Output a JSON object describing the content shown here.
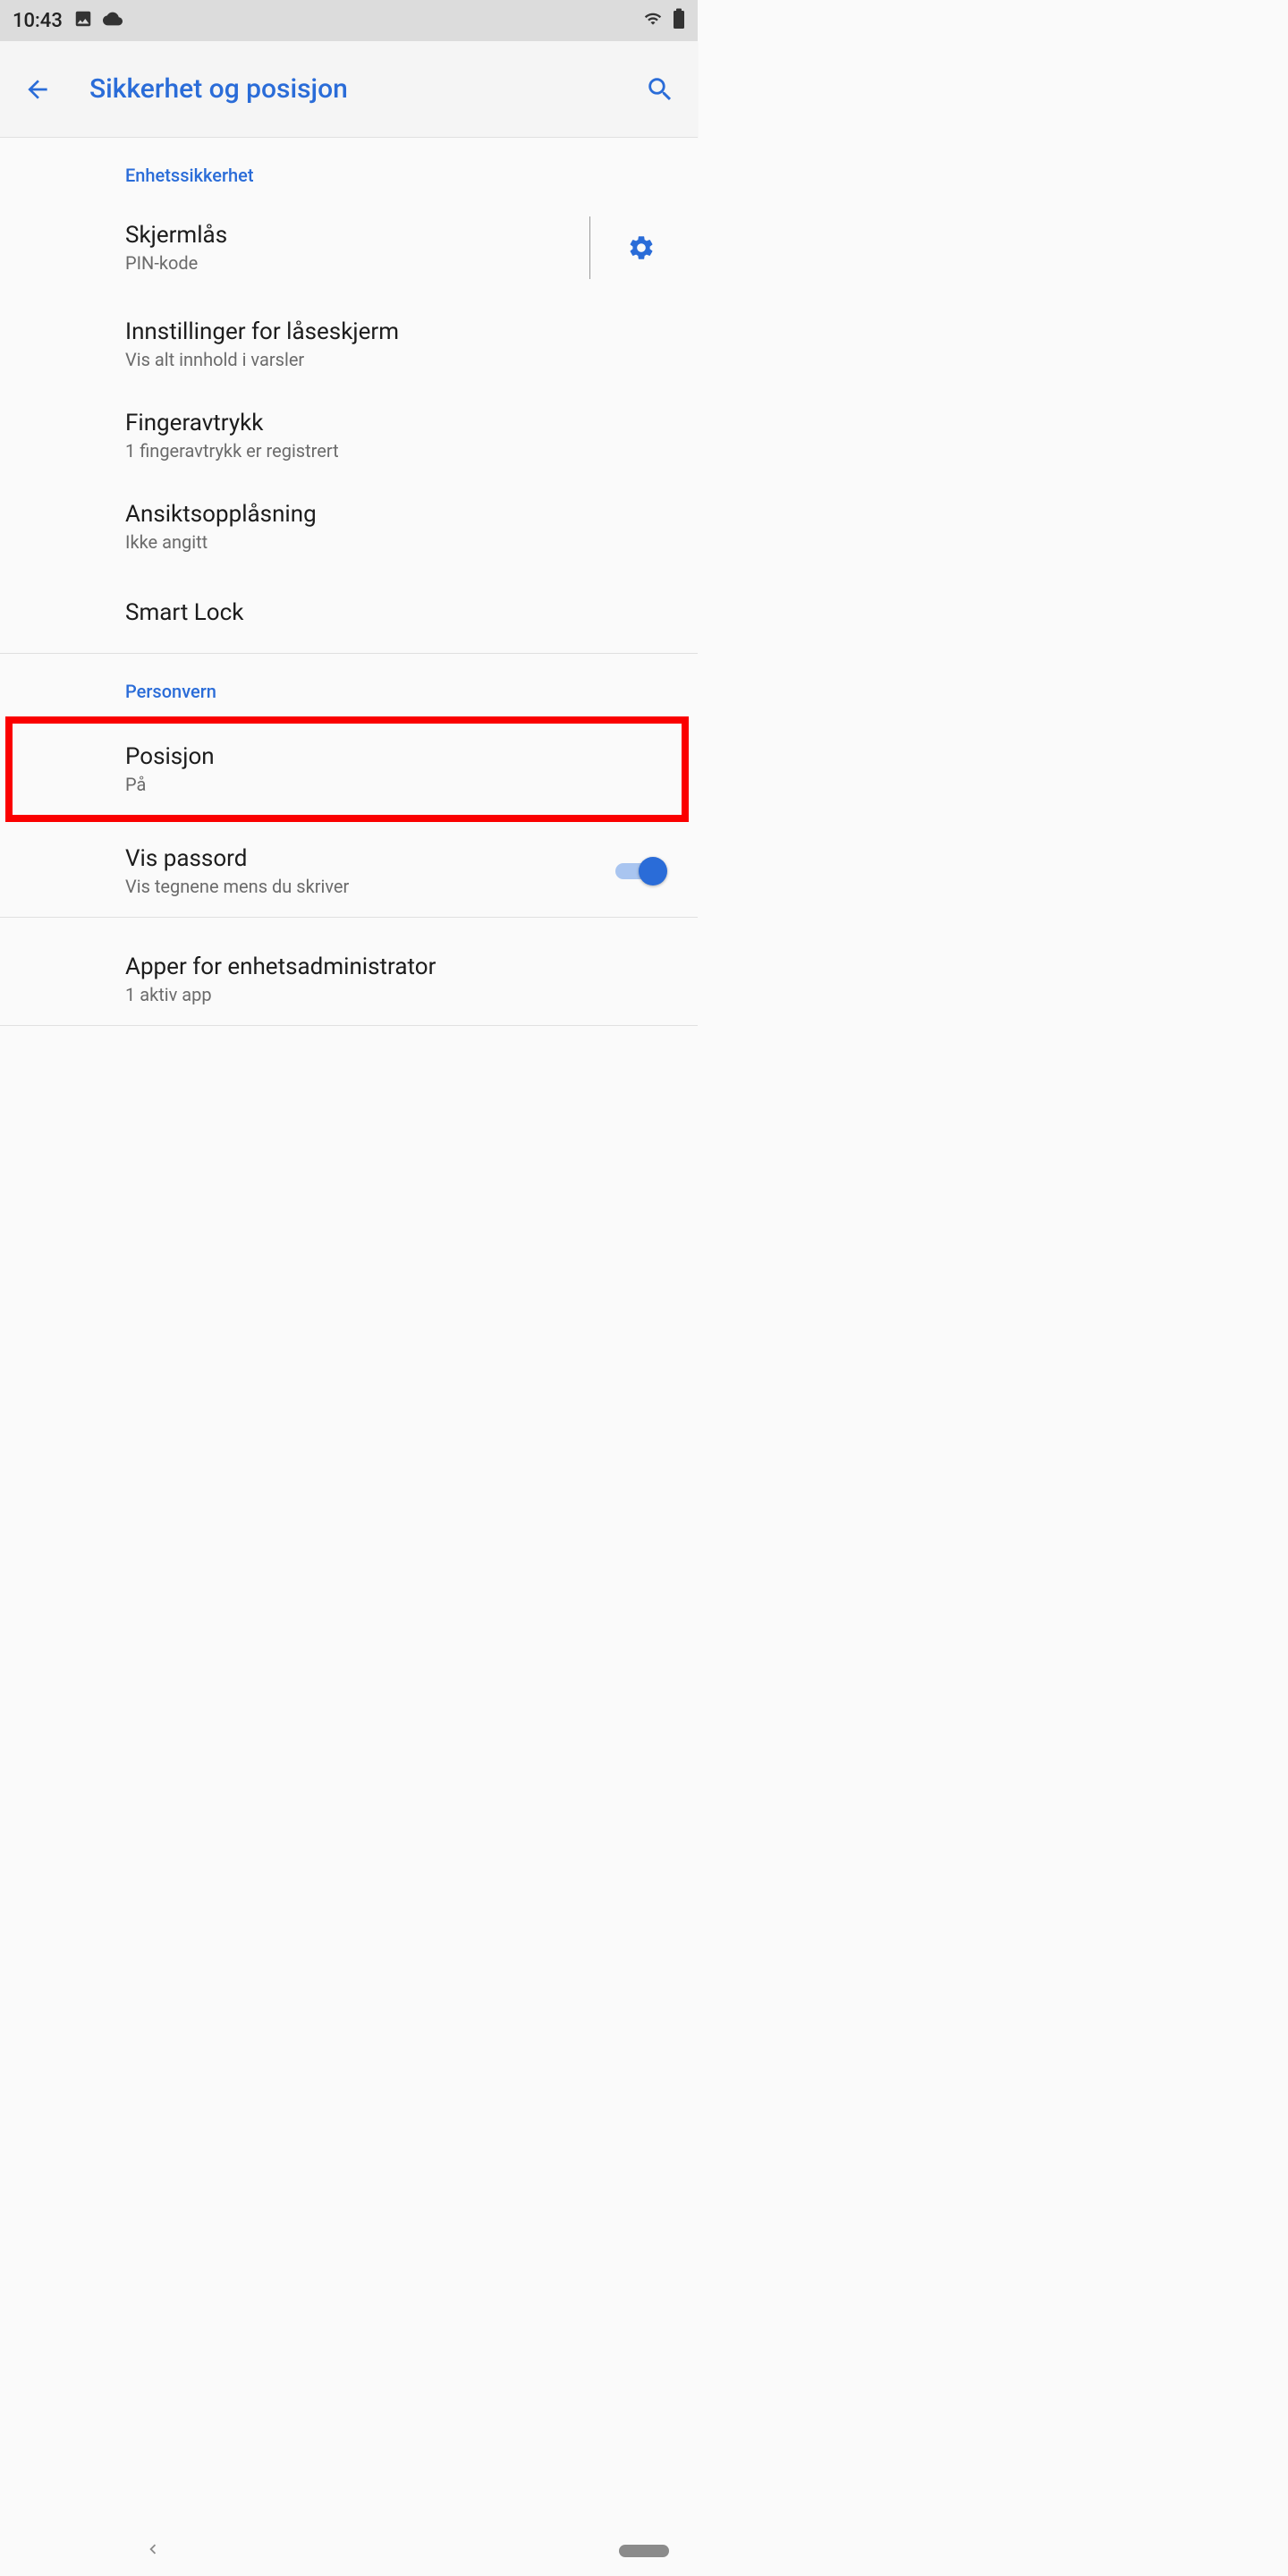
{
  "status": {
    "time": "10:43"
  },
  "header": {
    "title": "Sikkerhet og posisjon"
  },
  "sections": {
    "device_security": {
      "label": "Enhetssikkerhet",
      "items": {
        "screen_lock": {
          "title": "Skjermlås",
          "sub": "PIN-kode"
        },
        "lockscreen_prefs": {
          "title": "Innstillinger for låseskjerm",
          "sub": "Vis alt innhold i varsler"
        },
        "fingerprint": {
          "title": "Fingeravtrykk",
          "sub": "1 fingeravtrykk er registrert"
        },
        "face_unlock": {
          "title": "Ansiktsopplåsning",
          "sub": "Ikke angitt"
        },
        "smart_lock": {
          "title": "Smart Lock"
        }
      }
    },
    "privacy": {
      "label": "Personvern",
      "items": {
        "location": {
          "title": "Posisjon",
          "sub": "På"
        },
        "show_passwords": {
          "title": "Vis passord",
          "sub": "Vis tegnene mens du skriver",
          "toggle": true
        },
        "device_admin_apps": {
          "title": "Apper for enhetsadministrator",
          "sub": "1 aktiv app"
        }
      }
    }
  }
}
